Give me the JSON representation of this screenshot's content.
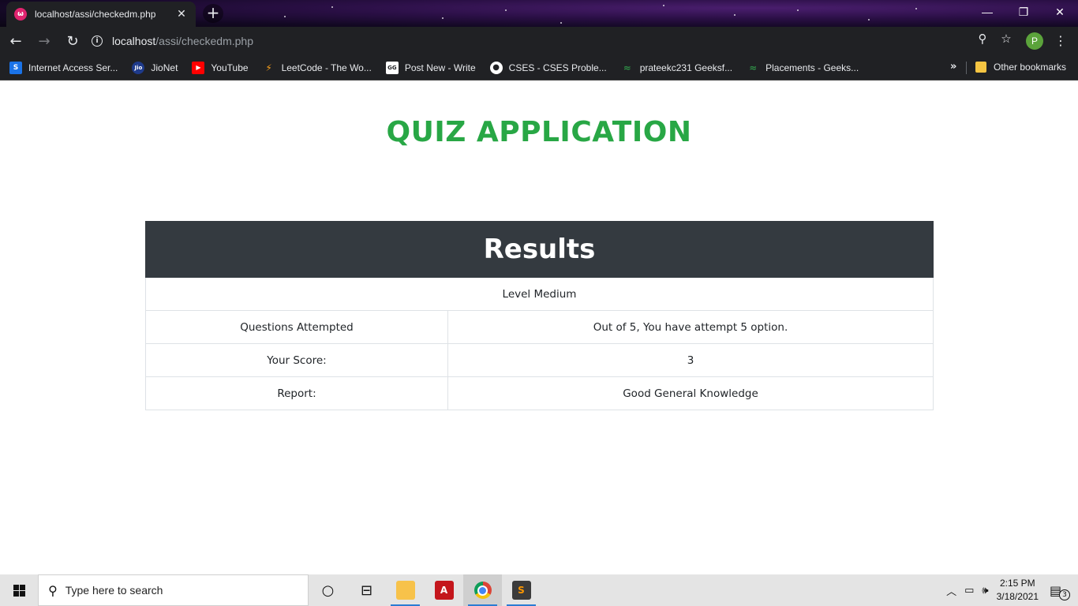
{
  "browser": {
    "tab_title": "localhost/assi/checkedm.php",
    "url_host": "localhost",
    "url_path": "/assi/checkedm.php",
    "profile_initial": "P",
    "bookmarks": [
      {
        "label": "Internet Access Ser...",
        "icon": "S",
        "color": "#1a73e8"
      },
      {
        "label": "JioNet",
        "icon": "Jio",
        "color": "#1e3a8a"
      },
      {
        "label": "YouTube",
        "icon": "▶",
        "color": "#ff0000"
      },
      {
        "label": "LeetCode - The Wo...",
        "icon": "⚡",
        "color": "#202124"
      },
      {
        "label": "Post New - Write",
        "icon": "GG",
        "color": "#ffffff"
      },
      {
        "label": "CSES - CSES Proble...",
        "icon": "●",
        "color": "#ffffff"
      },
      {
        "label": "prateekc231 Geeksf...",
        "icon": "≈",
        "color": "#202124"
      },
      {
        "label": "Placements - Geeks...",
        "icon": "≈",
        "color": "#202124"
      }
    ],
    "bookmarks_overflow": "»",
    "other_bookmarks": "Other bookmarks"
  },
  "page": {
    "app_title": "QUIZ APPLICATION",
    "results": {
      "heading": "Results",
      "level": "Level Medium",
      "rows": [
        {
          "label": "Questions Attempted",
          "value": "Out of 5, You have attempt 5 option."
        },
        {
          "label": "Your Score:",
          "value": "3"
        },
        {
          "label": "Report:",
          "value": "Good General Knowledge"
        }
      ]
    }
  },
  "taskbar": {
    "search_placeholder": "Type here to search",
    "time": "2:15 PM",
    "date": "3/18/2021",
    "notification_count": "3"
  }
}
